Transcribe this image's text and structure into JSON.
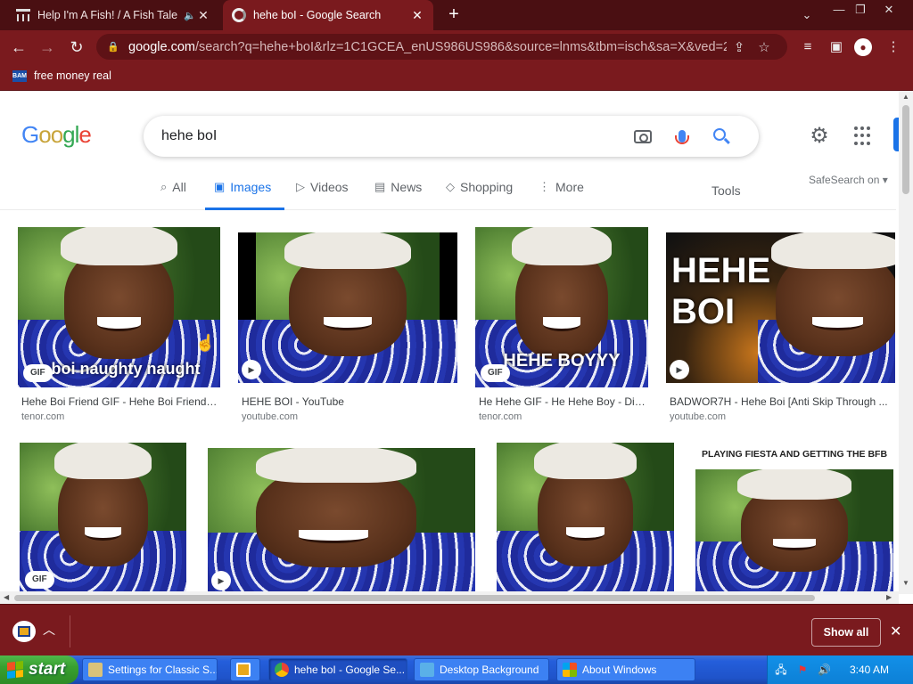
{
  "browser": {
    "tabs": [
      {
        "title": "Help I'm A Fish! / A Fish Tale",
        "icon": "museum-icon",
        "audio": true
      },
      {
        "title": "hehe boI - Google Search",
        "icon": "google-icon",
        "active": true
      }
    ],
    "new_tab": "+",
    "window_controls": {
      "minimize": "—",
      "restore": "❐",
      "close": "✕",
      "dropdown": "⌄"
    },
    "nav": {
      "back": "←",
      "forward": "→",
      "reload": "↻"
    },
    "url_host": "google.com",
    "url_rest": "/search?q=hehe+boI&rlz=1C1GCEA_enUS986US986&source=lnms&tbm=isch&sa=X&ved=2a...",
    "bookmark": {
      "label": "free money real",
      "icon_text": "BAM"
    }
  },
  "google": {
    "logo": "Google",
    "query": "hehe boI",
    "tabs": [
      {
        "label": "All",
        "icon": "search-icon"
      },
      {
        "label": "Images",
        "icon": "image-icon",
        "active": true
      },
      {
        "label": "Videos",
        "icon": "play-icon"
      },
      {
        "label": "News",
        "icon": "news-icon"
      },
      {
        "label": "Shopping",
        "icon": "tag-icon"
      },
      {
        "label": "More",
        "icon": "more-icon"
      }
    ],
    "tools": "Tools",
    "safesearch": "SafeSearch on"
  },
  "results_row1": [
    {
      "title": "Hehe Boi Friend GIF - Hehe Boi Friend ...",
      "source": "tenor.com",
      "badge": "GIF",
      "caption": "e boi naughty naught"
    },
    {
      "title": "HEHE BOI - YouTube",
      "source": "youtube.com",
      "badge": "▶"
    },
    {
      "title": "He Hehe GIF - He Hehe Boy - Dis...",
      "source": "tenor.com",
      "badge": "GIF",
      "caption": "HEHE BOYYY"
    },
    {
      "title": "BADWOR7H - Hehe Boi [Anti Skip Through ...",
      "source": "youtube.com",
      "badge": "▶",
      "caption": "HEHE BOI"
    }
  ],
  "results_row2": [
    {
      "badge": "GIF"
    },
    {
      "badge": "▶"
    },
    {},
    {
      "caption": "PLAYING FIESTA AND GETTING THE BFB"
    }
  ],
  "download_bar": {
    "show_all": "Show all",
    "close": "✕"
  },
  "taskbar": {
    "start": "start",
    "items": [
      {
        "label": "Settings for Classic S..."
      },
      {
        "label": ""
      },
      {
        "label": "hehe boI - Google Se...",
        "active": true
      },
      {
        "label": "Desktop Background"
      },
      {
        "label": "About Windows"
      }
    ],
    "clock": "3:40 AM"
  }
}
